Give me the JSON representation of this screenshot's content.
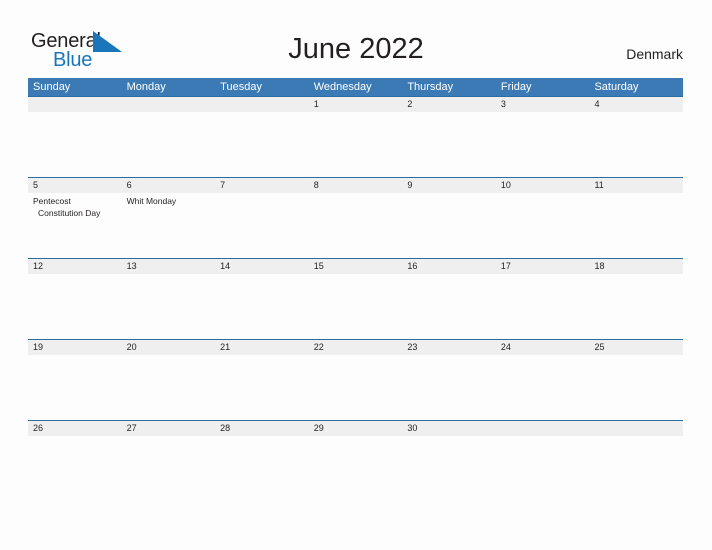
{
  "brand": {
    "name_part1": "General",
    "name_part2": "Blue",
    "flag_icon": "triangle-flag-icon",
    "accent_color": "#1b75bb"
  },
  "header": {
    "title": "June 2022",
    "country": "Denmark"
  },
  "theme": {
    "header_blue": "#3c7ab5",
    "band_gray": "#efefef",
    "band_border": "#2b6ca3",
    "text_dark": "#231f20",
    "page_background": "#fdfdfd"
  },
  "calendar": {
    "weekdays": [
      "Sunday",
      "Monday",
      "Tuesday",
      "Wednesday",
      "Thursday",
      "Friday",
      "Saturday"
    ],
    "weeks": [
      {
        "days": [
          {
            "number": "",
            "events": []
          },
          {
            "number": "",
            "events": []
          },
          {
            "number": "",
            "events": []
          },
          {
            "number": "1",
            "events": []
          },
          {
            "number": "2",
            "events": []
          },
          {
            "number": "3",
            "events": []
          },
          {
            "number": "4",
            "events": []
          }
        ]
      },
      {
        "days": [
          {
            "number": "5",
            "events": [
              "Pentecost",
              "Constitution Day"
            ]
          },
          {
            "number": "6",
            "events": [
              "Whit Monday"
            ]
          },
          {
            "number": "7",
            "events": []
          },
          {
            "number": "8",
            "events": []
          },
          {
            "number": "9",
            "events": []
          },
          {
            "number": "10",
            "events": []
          },
          {
            "number": "11",
            "events": []
          }
        ]
      },
      {
        "days": [
          {
            "number": "12",
            "events": []
          },
          {
            "number": "13",
            "events": []
          },
          {
            "number": "14",
            "events": []
          },
          {
            "number": "15",
            "events": []
          },
          {
            "number": "16",
            "events": []
          },
          {
            "number": "17",
            "events": []
          },
          {
            "number": "18",
            "events": []
          }
        ]
      },
      {
        "days": [
          {
            "number": "19",
            "events": []
          },
          {
            "number": "20",
            "events": []
          },
          {
            "number": "21",
            "events": []
          },
          {
            "number": "22",
            "events": []
          },
          {
            "number": "23",
            "events": []
          },
          {
            "number": "24",
            "events": []
          },
          {
            "number": "25",
            "events": []
          }
        ]
      },
      {
        "days": [
          {
            "number": "26",
            "events": []
          },
          {
            "number": "27",
            "events": []
          },
          {
            "number": "28",
            "events": []
          },
          {
            "number": "29",
            "events": []
          },
          {
            "number": "30",
            "events": []
          },
          {
            "number": "",
            "events": []
          },
          {
            "number": "",
            "events": []
          }
        ]
      }
    ]
  }
}
